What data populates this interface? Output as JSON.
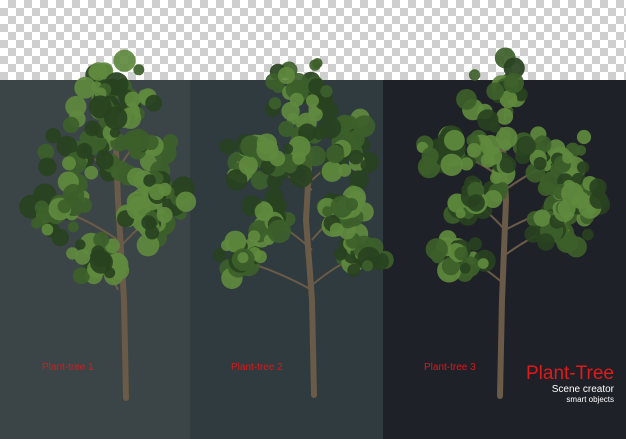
{
  "colors": {
    "panel_1": "#3b4547",
    "panel_2": "#2f3b3e",
    "panel_3": "#1f2128",
    "caption": "#d8191b",
    "brand": "#e01a1a",
    "foliage_dark": "#28421f",
    "foliage_mid": "#3d5f2a",
    "foliage_light": "#5f8a3e",
    "trunk": "#6a5a48"
  },
  "trees": [
    {
      "label": "Plant-tree 1"
    },
    {
      "label": "Plant-tree 2"
    },
    {
      "label": "Plant-tree 3"
    }
  ],
  "brand": {
    "title": "Plant-Tree",
    "subtitle": "Scene creator",
    "tagline": "smart objects"
  }
}
